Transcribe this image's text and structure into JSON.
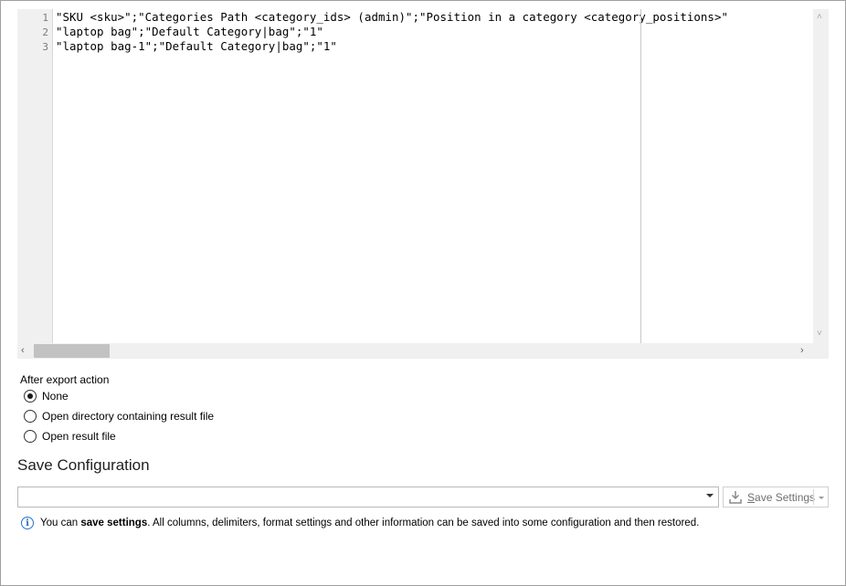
{
  "editor": {
    "lines": [
      {
        "num": "1",
        "text": "\"SKU <sku>\";\"Categories Path <category_ids> (admin)\";\"Position in a category <category_positions>\""
      },
      {
        "num": "2",
        "text": "\"laptop bag\";\"Default Category|bag\";\"1\""
      },
      {
        "num": "3",
        "text": "\"laptop bag-1\";\"Default Category|bag\";\"1\""
      }
    ]
  },
  "after_export": {
    "label": "After export action",
    "options": [
      {
        "label": "None",
        "checked": true
      },
      {
        "label": "Open directory containing result file",
        "checked": false
      },
      {
        "label": "Open result file",
        "checked": false
      }
    ]
  },
  "save_config": {
    "title": "Save Configuration",
    "combo_value": "",
    "button_label_underlined": "S",
    "button_label_rest": "ave Settings",
    "info_prefix": "You can ",
    "info_bold": "save settings",
    "info_suffix": ". All columns, delimiters, format settings and other information can be saved into some configuration and then restored."
  },
  "colors": {
    "info_blue": "#2a6fc9",
    "scroll_bg": "#f0f0f0"
  }
}
